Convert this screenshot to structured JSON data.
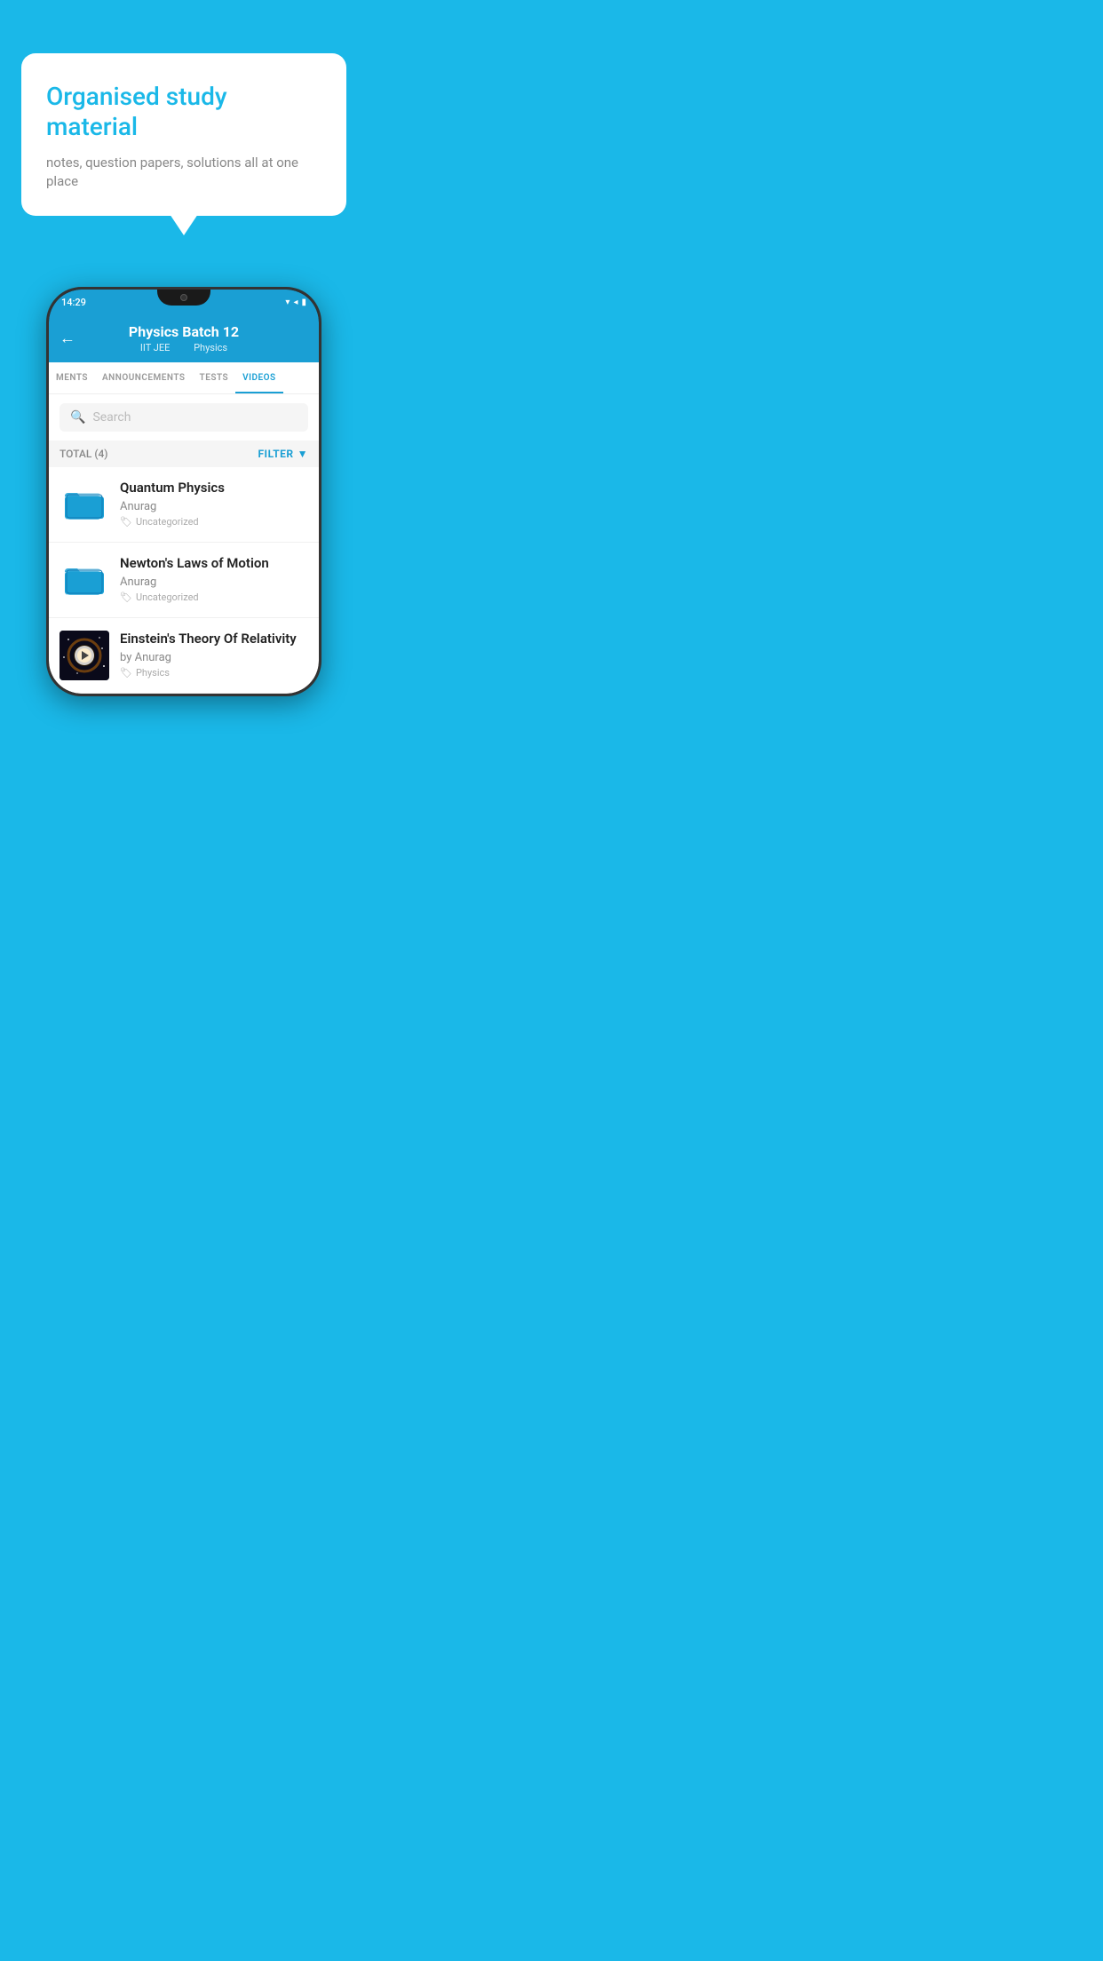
{
  "background_color": "#1ab8e8",
  "speech_bubble": {
    "title": "Organised study material",
    "subtitle": "notes, question papers, solutions all at one place"
  },
  "phone": {
    "status_bar": {
      "time": "14:29",
      "icons": "▾◂▮"
    },
    "header": {
      "back_label": "←",
      "title": "Physics Batch 12",
      "subtitle_part1": "IIT JEE",
      "subtitle_part2": "Physics"
    },
    "tabs": [
      {
        "label": "MENTS",
        "active": false
      },
      {
        "label": "ANNOUNCEMENTS",
        "active": false
      },
      {
        "label": "TESTS",
        "active": false
      },
      {
        "label": "VIDEOS",
        "active": true
      }
    ],
    "search": {
      "placeholder": "Search"
    },
    "filter": {
      "total_label": "TOTAL (4)",
      "filter_label": "FILTER"
    },
    "videos": [
      {
        "type": "folder",
        "title": "Quantum Physics",
        "author": "Anurag",
        "tag": "Uncategorized"
      },
      {
        "type": "folder",
        "title": "Newton's Laws of Motion",
        "author": "Anurag",
        "tag": "Uncategorized"
      },
      {
        "type": "video",
        "title": "Einstein's Theory Of Relativity",
        "author": "by Anurag",
        "tag": "Physics"
      }
    ]
  }
}
